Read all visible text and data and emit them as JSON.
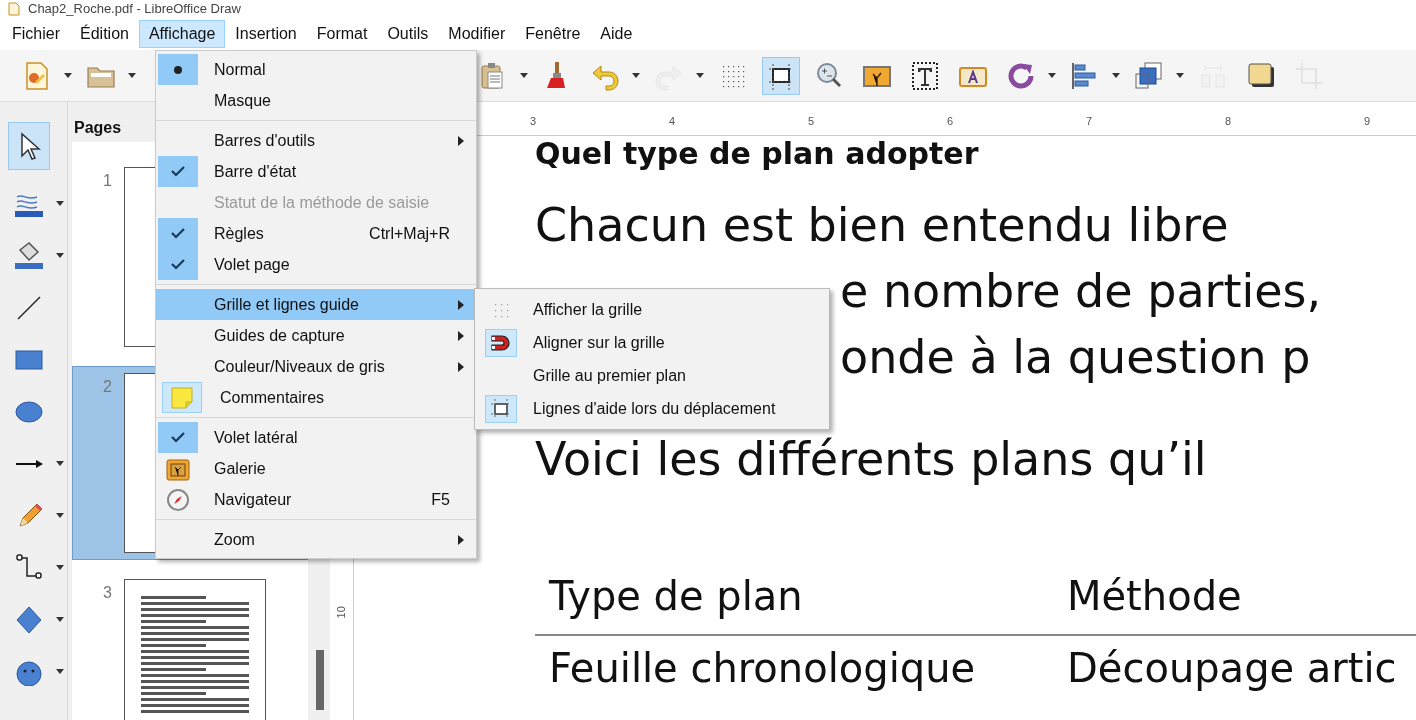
{
  "window": {
    "title": "Chap2_Roche.pdf - LibreOffice Draw"
  },
  "menubar": [
    {
      "label": "Fichier",
      "selected": false
    },
    {
      "label": "Édition",
      "selected": false
    },
    {
      "label": "Affichage",
      "selected": true
    },
    {
      "label": "Insertion",
      "selected": false
    },
    {
      "label": "Format",
      "selected": false
    },
    {
      "label": "Outils",
      "selected": false
    },
    {
      "label": "Modifier",
      "selected": false
    },
    {
      "label": "Fenêtre",
      "selected": false
    },
    {
      "label": "Aide",
      "selected": false
    }
  ],
  "toolbar": [
    {
      "kind": "new",
      "dropdown": true,
      "selected": false,
      "disabled": false
    },
    {
      "kind": "open",
      "dropdown": true,
      "selected": false,
      "disabled": false
    },
    {
      "kind": "paste",
      "dropdown": true,
      "selected": false,
      "disabled": false
    },
    {
      "kind": "clone",
      "dropdown": false,
      "selected": false,
      "disabled": false
    },
    {
      "kind": "undo",
      "dropdown": true,
      "selected": false,
      "disabled": false
    },
    {
      "kind": "redo",
      "dropdown": true,
      "selected": false,
      "disabled": true
    },
    {
      "kind": "grid",
      "dropdown": false,
      "selected": false,
      "disabled": false
    },
    {
      "kind": "helplines",
      "dropdown": false,
      "selected": true,
      "disabled": false
    },
    {
      "kind": "zoom",
      "dropdown": false,
      "selected": false,
      "disabled": false
    },
    {
      "kind": "image",
      "dropdown": false,
      "selected": false,
      "disabled": false
    },
    {
      "kind": "text",
      "dropdown": false,
      "selected": false,
      "disabled": false
    },
    {
      "kind": "fontwork",
      "dropdown": false,
      "selected": false,
      "disabled": false
    },
    {
      "kind": "rotate",
      "dropdown": true,
      "selected": false,
      "disabled": false
    },
    {
      "kind": "align",
      "dropdown": true,
      "selected": false,
      "disabled": false
    },
    {
      "kind": "arrange",
      "dropdown": true,
      "selected": false,
      "disabled": false
    },
    {
      "kind": "distribute",
      "dropdown": false,
      "selected": false,
      "disabled": true
    },
    {
      "kind": "shadow",
      "dropdown": false,
      "selected": false,
      "disabled": false
    },
    {
      "kind": "crop",
      "dropdown": false,
      "selected": false,
      "disabled": true
    }
  ],
  "toolbox": [
    {
      "kind": "select",
      "dropdown": false,
      "selected": true
    },
    {
      "kind": "linecolor",
      "dropdown": true,
      "selected": false
    },
    {
      "kind": "fill",
      "dropdown": true,
      "selected": false
    },
    {
      "kind": "line",
      "dropdown": false,
      "selected": false
    },
    {
      "kind": "rect",
      "dropdown": false,
      "selected": false
    },
    {
      "kind": "ellipse",
      "dropdown": false,
      "selected": false
    },
    {
      "kind": "arrow",
      "dropdown": true,
      "selected": false
    },
    {
      "kind": "pencil",
      "dropdown": true,
      "selected": false
    },
    {
      "kind": "connector",
      "dropdown": true,
      "selected": false
    },
    {
      "kind": "diamond",
      "dropdown": true,
      "selected": false
    },
    {
      "kind": "smiley",
      "dropdown": true,
      "selected": false
    }
  ],
  "pages_panel": {
    "title": "Pages",
    "pages": [
      {
        "number": "1",
        "kind": "blank",
        "selected": false
      },
      {
        "number": "2",
        "kind": "blank",
        "selected": true
      },
      {
        "number": "3",
        "kind": "text",
        "selected": false
      }
    ]
  },
  "ruler": {
    "marks": [
      "3",
      "4",
      "5",
      "6",
      "7",
      "8",
      "9"
    ]
  },
  "vertical_ruler": {
    "marks": [
      "10"
    ]
  },
  "document": {
    "heading": "Quel type de plan adopter",
    "lines": [
      {
        "text": "Chacun est bien entendu libre",
        "kind": "full"
      },
      {
        "text": "e nombre de parties,",
        "kind": "partial"
      },
      {
        "text": "onde à la question p",
        "kind": "partial"
      },
      {
        "text": "Voici les différents plans qu’il",
        "kind": "full"
      }
    ],
    "table": {
      "columns": [
        "Type de plan",
        "Méthode"
      ],
      "rows": [
        [
          "Feuille chronologique",
          "Découpage artic"
        ]
      ]
    }
  },
  "menu": {
    "sections": [
      [
        {
          "label": "Normal",
          "kind": "radio",
          "checked": true,
          "selected": false,
          "disabled": false,
          "submenu": false
        },
        {
          "label": "Masque",
          "kind": "radio",
          "checked": false,
          "selected": false,
          "disabled": false,
          "submenu": false
        }
      ],
      [
        {
          "label": "Barres d'outils",
          "kind": "check",
          "checked": false,
          "selected": false,
          "disabled": false,
          "submenu": true
        },
        {
          "label": "Barre d'état",
          "kind": "check",
          "checked": true,
          "selected": false,
          "disabled": false,
          "submenu": false
        },
        {
          "label": "Statut de la méthode de saisie",
          "kind": "check",
          "checked": false,
          "selected": false,
          "disabled": true,
          "submenu": false
        },
        {
          "label": "Règles",
          "kind": "check",
          "checked": true,
          "selected": false,
          "disabled": false,
          "submenu": false,
          "shortcut": "Ctrl+Maj+R"
        },
        {
          "label": "Volet page",
          "kind": "check",
          "checked": true,
          "selected": false,
          "disabled": false,
          "submenu": false
        }
      ],
      [
        {
          "label": "Grille et lignes guide",
          "kind": "check",
          "checked": false,
          "selected": true,
          "disabled": false,
          "submenu": true
        },
        {
          "label": "Guides de capture",
          "kind": "check",
          "checked": false,
          "selected": false,
          "disabled": false,
          "submenu": true
        },
        {
          "label": "Couleur/Niveaux de gris",
          "kind": "check",
          "checked": false,
          "selected": false,
          "disabled": false,
          "submenu": true
        },
        {
          "label": "Commentaires",
          "kind": "note",
          "checked": true,
          "selected": false,
          "disabled": false,
          "submenu": false
        }
      ],
      [
        {
          "label": "Volet latéral",
          "kind": "check",
          "checked": true,
          "selected": false,
          "disabled": false,
          "submenu": false
        },
        {
          "label": "Galerie",
          "kind": "gallery",
          "checked": false,
          "selected": false,
          "disabled": false,
          "submenu": false
        },
        {
          "label": "Navigateur",
          "kind": "compass",
          "checked": false,
          "selected": false,
          "disabled": false,
          "submenu": false,
          "shortcut": "F5"
        }
      ],
      [
        {
          "label": "Zoom",
          "kind": "check",
          "checked": false,
          "selected": false,
          "disabled": false,
          "submenu": true
        }
      ]
    ]
  },
  "submenu": {
    "items": [
      {
        "label": "Afficher la grille",
        "kind": "grid",
        "checked": false
      },
      {
        "label": "Aligner sur la grille",
        "kind": "magnet",
        "checked": true
      },
      {
        "label": "Grille au premier plan",
        "kind": "plain",
        "checked": false
      },
      {
        "label": "Lignes d'aide lors du déplacement",
        "kind": "helplines",
        "checked": true
      }
    ]
  }
}
